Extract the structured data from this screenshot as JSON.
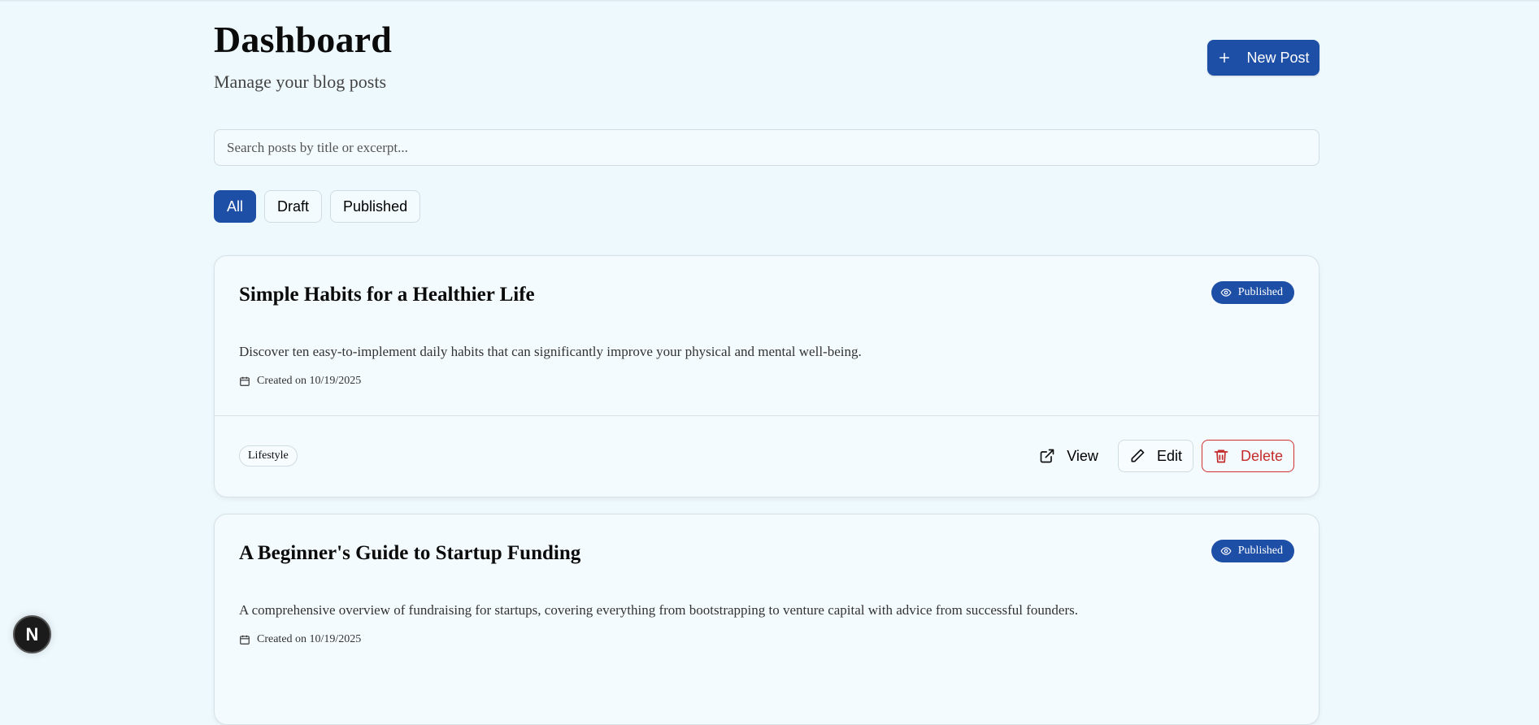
{
  "header": {
    "title": "Dashboard",
    "subtitle": "Manage your blog posts",
    "new_post_label": "New Post"
  },
  "search": {
    "placeholder": "Search posts by title or excerpt...",
    "value": ""
  },
  "filters": [
    {
      "label": "All",
      "active": true
    },
    {
      "label": "Draft",
      "active": false
    },
    {
      "label": "Published",
      "active": false
    }
  ],
  "posts": [
    {
      "title": "Simple Habits for a Healthier Life",
      "status": "Published",
      "excerpt": "Discover ten easy-to-implement daily habits that can significantly improve your physical and mental well-being.",
      "created": "Created on 10/19/2025",
      "tag": "Lifestyle",
      "actions": {
        "view": "View",
        "edit": "Edit",
        "delete": "Delete"
      }
    },
    {
      "title": "A Beginner's Guide to Startup Funding",
      "status": "Published",
      "excerpt": "A comprehensive overview of fundraising for startups, covering everything from bootstrapping to venture capital with advice from successful founders.",
      "created": "Created on 10/19/2025"
    }
  ],
  "dev_badge": {
    "label": "N"
  },
  "colors": {
    "background": "#eef9fd",
    "accent": "#1e4fa6",
    "danger": "#c42b2b"
  },
  "icons": [
    "plus-icon",
    "eye-icon",
    "calendar-icon",
    "external-link-icon",
    "pencil-icon",
    "trash-icon"
  ]
}
